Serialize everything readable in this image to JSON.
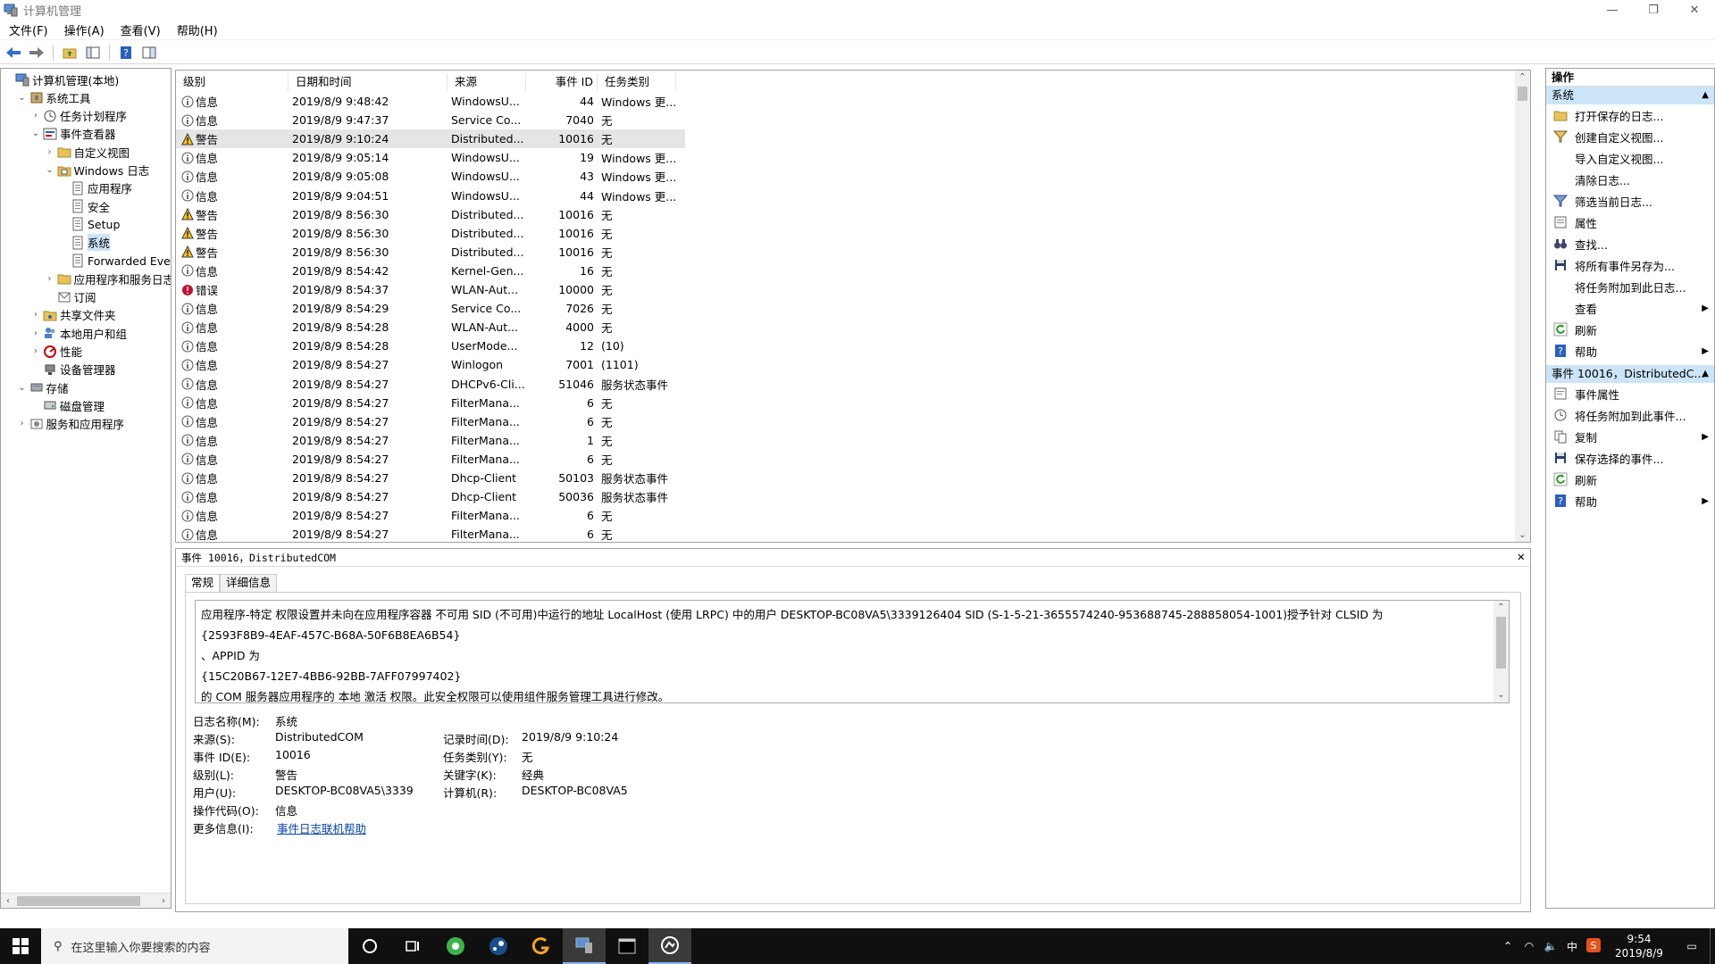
{
  "window": {
    "title": "计算机管理",
    "minimize": "—",
    "restore": "❐",
    "close": "✕"
  },
  "menu": [
    "文件(F)",
    "操作(A)",
    "查看(V)",
    "帮助(H)"
  ],
  "tree": [
    {
      "label": "计算机管理(本地)",
      "indent": 0,
      "arrow": "",
      "icon": "computer-icon"
    },
    {
      "label": "系统工具",
      "indent": 1,
      "arrow": "⌄",
      "icon": "tools-icon"
    },
    {
      "label": "任务计划程序",
      "indent": 2,
      "arrow": "›",
      "icon": "clock-icon"
    },
    {
      "label": "事件查看器",
      "indent": 2,
      "arrow": "⌄",
      "icon": "event-viewer-icon"
    },
    {
      "label": "自定义视图",
      "indent": 3,
      "arrow": "›",
      "icon": "folder-icon"
    },
    {
      "label": "Windows 日志",
      "indent": 3,
      "arrow": "⌄",
      "icon": "log-folder-icon"
    },
    {
      "label": "应用程序",
      "indent": 4,
      "arrow": "",
      "icon": "log-icon"
    },
    {
      "label": "安全",
      "indent": 4,
      "arrow": "",
      "icon": "log-icon"
    },
    {
      "label": "Setup",
      "indent": 4,
      "arrow": "",
      "icon": "log-icon"
    },
    {
      "label": "系统",
      "indent": 4,
      "arrow": "",
      "icon": "log-icon",
      "selected": true
    },
    {
      "label": "Forwarded Eve",
      "indent": 4,
      "arrow": "",
      "icon": "log-icon"
    },
    {
      "label": "应用程序和服务日志",
      "indent": 3,
      "arrow": "›",
      "icon": "folder-icon"
    },
    {
      "label": "订阅",
      "indent": 3,
      "arrow": "",
      "icon": "subscription-icon"
    },
    {
      "label": "共享文件夹",
      "indent": 2,
      "arrow": "›",
      "icon": "shared-folder-icon"
    },
    {
      "label": "本地用户和组",
      "indent": 2,
      "arrow": "›",
      "icon": "users-icon"
    },
    {
      "label": "性能",
      "indent": 2,
      "arrow": "›",
      "icon": "performance-icon"
    },
    {
      "label": "设备管理器",
      "indent": 2,
      "arrow": "",
      "icon": "device-manager-icon"
    },
    {
      "label": "存储",
      "indent": 1,
      "arrow": "⌄",
      "icon": "storage-icon"
    },
    {
      "label": "磁盘管理",
      "indent": 2,
      "arrow": "",
      "icon": "disk-icon"
    },
    {
      "label": "服务和应用程序",
      "indent": 1,
      "arrow": "›",
      "icon": "services-icon"
    }
  ],
  "grid": {
    "columns": [
      "级别",
      "日期和时间",
      "来源",
      "事件 ID",
      "任务类别"
    ],
    "rows": [
      {
        "type": "info",
        "level": "信息",
        "date": "2019/8/9 9:48:42",
        "source": "WindowsU...",
        "id": "44",
        "task": "Windows 更..."
      },
      {
        "type": "info",
        "level": "信息",
        "date": "2019/8/9 9:47:37",
        "source": "Service Co...",
        "id": "7040",
        "task": "无"
      },
      {
        "type": "warn",
        "level": "警告",
        "date": "2019/8/9 9:10:24",
        "source": "Distributed...",
        "id": "10016",
        "task": "无",
        "selected": true
      },
      {
        "type": "info",
        "level": "信息",
        "date": "2019/8/9 9:05:14",
        "source": "WindowsU...",
        "id": "19",
        "task": "Windows 更..."
      },
      {
        "type": "info",
        "level": "信息",
        "date": "2019/8/9 9:05:08",
        "source": "WindowsU...",
        "id": "43",
        "task": "Windows 更..."
      },
      {
        "type": "info",
        "level": "信息",
        "date": "2019/8/9 9:04:51",
        "source": "WindowsU...",
        "id": "44",
        "task": "Windows 更..."
      },
      {
        "type": "warn",
        "level": "警告",
        "date": "2019/8/9 8:56:30",
        "source": "Distributed...",
        "id": "10016",
        "task": "无"
      },
      {
        "type": "warn",
        "level": "警告",
        "date": "2019/8/9 8:56:30",
        "source": "Distributed...",
        "id": "10016",
        "task": "无"
      },
      {
        "type": "warn",
        "level": "警告",
        "date": "2019/8/9 8:56:30",
        "source": "Distributed...",
        "id": "10016",
        "task": "无"
      },
      {
        "type": "info",
        "level": "信息",
        "date": "2019/8/9 8:54:42",
        "source": "Kernel-Gen...",
        "id": "16",
        "task": "无"
      },
      {
        "type": "error",
        "level": "错误",
        "date": "2019/8/9 8:54:37",
        "source": "WLAN-Aut...",
        "id": "10000",
        "task": "无"
      },
      {
        "type": "info",
        "level": "信息",
        "date": "2019/8/9 8:54:29",
        "source": "Service Co...",
        "id": "7026",
        "task": "无"
      },
      {
        "type": "info",
        "level": "信息",
        "date": "2019/8/9 8:54:28",
        "source": "WLAN-Aut...",
        "id": "4000",
        "task": "无"
      },
      {
        "type": "info",
        "level": "信息",
        "date": "2019/8/9 8:54:28",
        "source": "UserMode...",
        "id": "12",
        "task": "(10)"
      },
      {
        "type": "info",
        "level": "信息",
        "date": "2019/8/9 8:54:27",
        "source": "Winlogon",
        "id": "7001",
        "task": "(1101)"
      },
      {
        "type": "info",
        "level": "信息",
        "date": "2019/8/9 8:54:27",
        "source": "DHCPv6-Cli...",
        "id": "51046",
        "task": "服务状态事件"
      },
      {
        "type": "info",
        "level": "信息",
        "date": "2019/8/9 8:54:27",
        "source": "FilterMana...",
        "id": "6",
        "task": "无"
      },
      {
        "type": "info",
        "level": "信息",
        "date": "2019/8/9 8:54:27",
        "source": "FilterMana...",
        "id": "6",
        "task": "无"
      },
      {
        "type": "info",
        "level": "信息",
        "date": "2019/8/9 8:54:27",
        "source": "FilterMana...",
        "id": "1",
        "task": "无"
      },
      {
        "type": "info",
        "level": "信息",
        "date": "2019/8/9 8:54:27",
        "source": "FilterMana...",
        "id": "6",
        "task": "无"
      },
      {
        "type": "info",
        "level": "信息",
        "date": "2019/8/9 8:54:27",
        "source": "Dhcp-Client",
        "id": "50103",
        "task": "服务状态事件"
      },
      {
        "type": "info",
        "level": "信息",
        "date": "2019/8/9 8:54:27",
        "source": "Dhcp-Client",
        "id": "50036",
        "task": "服务状态事件"
      },
      {
        "type": "info",
        "level": "信息",
        "date": "2019/8/9 8:54:27",
        "source": "FilterMana...",
        "id": "6",
        "task": "无"
      },
      {
        "type": "info",
        "level": "信息",
        "date": "2019/8/9 8:54:27",
        "source": "FilterMana...",
        "id": "6",
        "task": "无"
      }
    ]
  },
  "detail": {
    "header": "事件 10016，DistributedCOM",
    "close": "✕",
    "tabs": [
      "常规",
      "详细信息"
    ],
    "message": [
      "应用程序-特定 权限设置并未向在应用程序容器 不可用 SID (不可用)中运行的地址 LocalHost (使用 LRPC) 中的用户 DESKTOP-BC08VA5\\3339126404 SID (S-1-5-21-3655574240-953688745-288858054-1001)授予针对 CLSID 为",
      "{2593F8B9-4EAF-457C-B68A-50F6B8EA6B54}",
      "、APPID 为",
      "{15C20B67-12E7-4BB6-92BB-7AFF07997402}",
      " 的 COM 服务器应用程序的 本地 激活 权限。此安全权限可以使用组件服务管理工具进行修改。"
    ],
    "fields": {
      "log_name_label": "日志名称(M):",
      "log_name": "系统",
      "source_label": "来源(S):",
      "source": "DistributedCOM",
      "logged_label": "记录时间(D):",
      "logged": "2019/8/9 9:10:24",
      "event_id_label": "事件 ID(E):",
      "event_id": "10016",
      "task_label": "任务类别(Y):",
      "task": "无",
      "level_label": "级别(L):",
      "level": "警告",
      "keywords_label": "关键字(K):",
      "keywords": "经典",
      "user_label": "用户(U):",
      "user": "DESKTOP-BC08VA5\\3339",
      "computer_label": "计算机(R):",
      "computer": "DESKTOP-BC08VA5",
      "opcode_label": "操作代码(O):",
      "opcode": "信息",
      "more_label": "更多信息(I):",
      "more_link": "事件日志联机帮助"
    }
  },
  "actions": {
    "title": "操作",
    "section1": "系统",
    "items1": [
      {
        "label": "打开保存的日志...",
        "icon": "open-folder-icon"
      },
      {
        "label": "创建自定义视图...",
        "icon": "filter-create-icon"
      },
      {
        "label": "导入自定义视图...",
        "icon": ""
      },
      {
        "label": "清除日志...",
        "icon": ""
      },
      {
        "label": "筛选当前日志...",
        "icon": "filter-icon"
      },
      {
        "label": "属性",
        "icon": "properties-icon"
      },
      {
        "label": "查找...",
        "icon": "binoculars-icon"
      },
      {
        "label": "将所有事件另存为...",
        "icon": "save-icon"
      },
      {
        "label": "将任务附加到此日志...",
        "icon": ""
      },
      {
        "label": "查看",
        "icon": "",
        "sub": true
      },
      {
        "label": "刷新",
        "icon": "refresh-icon"
      },
      {
        "label": "帮助",
        "icon": "help-icon",
        "sub": true
      }
    ],
    "section2": "事件 10016，DistributedC...",
    "items2": [
      {
        "label": "事件属性",
        "icon": "event-properties-icon"
      },
      {
        "label": "将任务附加到此事件...",
        "icon": "attach-task-icon"
      },
      {
        "label": "复制",
        "icon": "copy-icon",
        "sub": true
      },
      {
        "label": "保存选择的事件...",
        "icon": "save-icon"
      },
      {
        "label": "刷新",
        "icon": "refresh-icon"
      },
      {
        "label": "帮助",
        "icon": "help-icon",
        "sub": true
      }
    ]
  },
  "taskbar": {
    "search_placeholder": "在这里输入你要搜索的内容",
    "time": "9:54",
    "date": "2019/8/9",
    "ime": "中"
  }
}
